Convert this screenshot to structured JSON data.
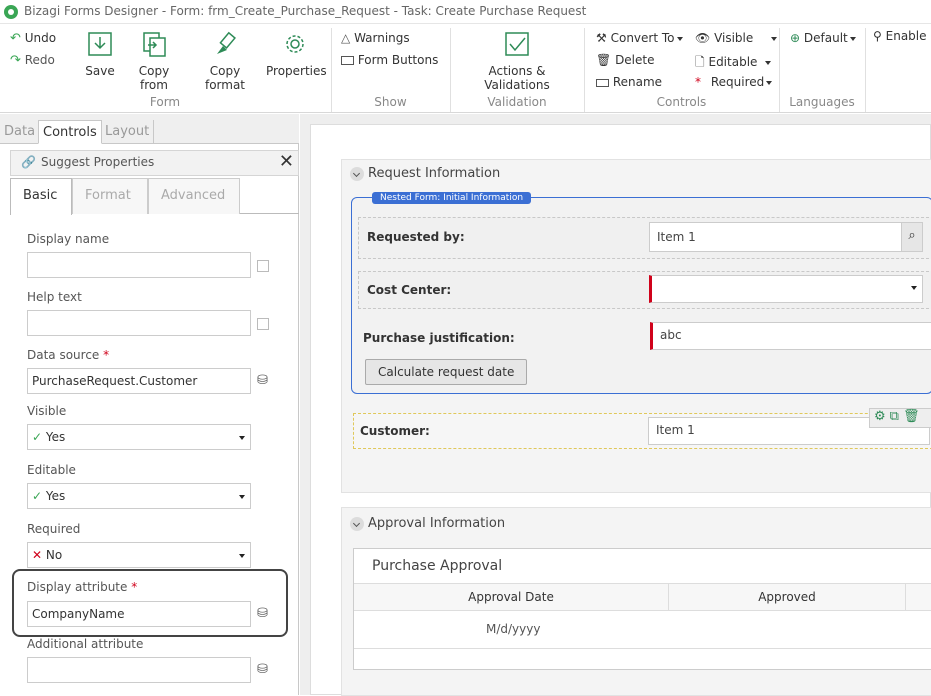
{
  "window": {
    "title": "Bizagi Forms Designer  -  Form: frm_Create_Purchase_Request - Task:  Create Purchase Request"
  },
  "ribbon": {
    "undo": "Undo",
    "redo": "Redo",
    "save": "Save",
    "copy_from": "Copy from",
    "copy_format": "Copy format",
    "properties": "Properties",
    "group_form": "Form",
    "warnings": "Warnings",
    "form_buttons": "Form Buttons",
    "group_show": "Show",
    "actions_validations": "Actions & Validations",
    "group_validation": "Validation",
    "convert_to": "Convert To",
    "delete": "Delete",
    "rename": "Rename",
    "visible": "Visible",
    "editable": "Editable",
    "required": "Required",
    "group_controls": "Controls",
    "default": "Default",
    "group_languages": "Languages",
    "enable": "Enable"
  },
  "left_tabs": [
    "Data",
    "Controls",
    "Layout"
  ],
  "suggest": {
    "title": "Suggest Properties"
  },
  "prop_tabs": [
    "Basic",
    "Format",
    "Advanced"
  ],
  "props": {
    "display_name_label": "Display name",
    "display_name_value": "",
    "help_text_label": "Help text",
    "help_text_value": "",
    "data_source_label": "Data source",
    "data_source_value": "PurchaseRequest.Customer",
    "visible_label": "Visible",
    "visible_value": "Yes",
    "editable_label": "Editable",
    "editable_value": "Yes",
    "required_label": "Required",
    "required_value": "No",
    "display_attr_label": "Display attribute",
    "display_attr_value": "CompanyName",
    "additional_attr_label": "Additional attribute",
    "additional_attr_value": "",
    "required_star": "*"
  },
  "form": {
    "section1_title": "Request Information",
    "nested_label": "Nested Form: Initial Information",
    "requested_by_label": "Requested by:",
    "requested_by_value": "Item 1",
    "cost_center_label": "Cost Center:",
    "cost_center_value": "",
    "justification_label": "Purchase justification:",
    "justification_value": "abc",
    "calc_button": "Calculate request date",
    "customer_label": "Customer:",
    "customer_value": "Item 1",
    "section2_title": "Approval Information",
    "grid_title": "Purchase Approval",
    "grid_columns": [
      "Approval Date",
      "Approved"
    ],
    "grid_row": [
      "M/d/yyyy",
      ""
    ]
  },
  "colors": {
    "required": "#d0021b",
    "check": "#3aa655",
    "nested_border": "#3b6fd4",
    "nested_badge": "#3b6fd4",
    "selected_border": "#e0c85a"
  }
}
